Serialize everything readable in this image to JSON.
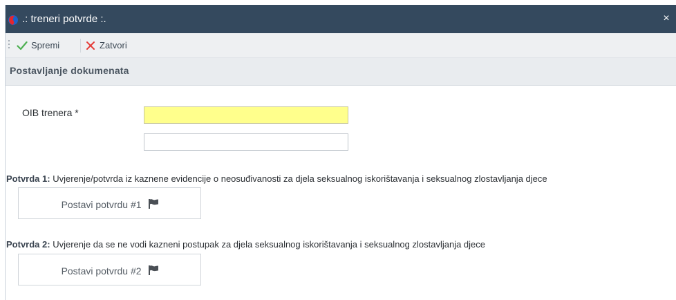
{
  "window": {
    "title": ".: treneri potvrde :.",
    "close_glyph": "×"
  },
  "toolbar": {
    "save_label": "Spremi",
    "close_label": "Zatvori"
  },
  "section": {
    "title": "Postavljanje dokumenata"
  },
  "form": {
    "oib_label": "OIB trenera *",
    "oib_value": "",
    "name_value": ""
  },
  "documents": [
    {
      "prefix": "Potvrda 1:",
      "text": " Uvjerenje/potvrda iz kaznene evidencije o neosuđivanosti za djela seksualnog iskorištavanja i seksualnog zlostavljanja djece",
      "button_label": "Postavi potvrdu #1"
    },
    {
      "prefix": "Potvrda 2:",
      "text": " Uvjerenje da se ne vodi kazneni postupak za djela seksualnog iskorištavanja i seksualnog zlostavljanja djece",
      "button_label": "Postavi potvrdu #2"
    }
  ],
  "icons": {
    "app": "app-logo-icon",
    "save": "checkmark-icon",
    "close": "x-icon",
    "upload": "flag-icon",
    "window_close": "close-icon"
  },
  "colors": {
    "titlebar": "#34495e",
    "required_field": "#ffff8c",
    "check": "#4caf50",
    "cross": "#e53935"
  }
}
